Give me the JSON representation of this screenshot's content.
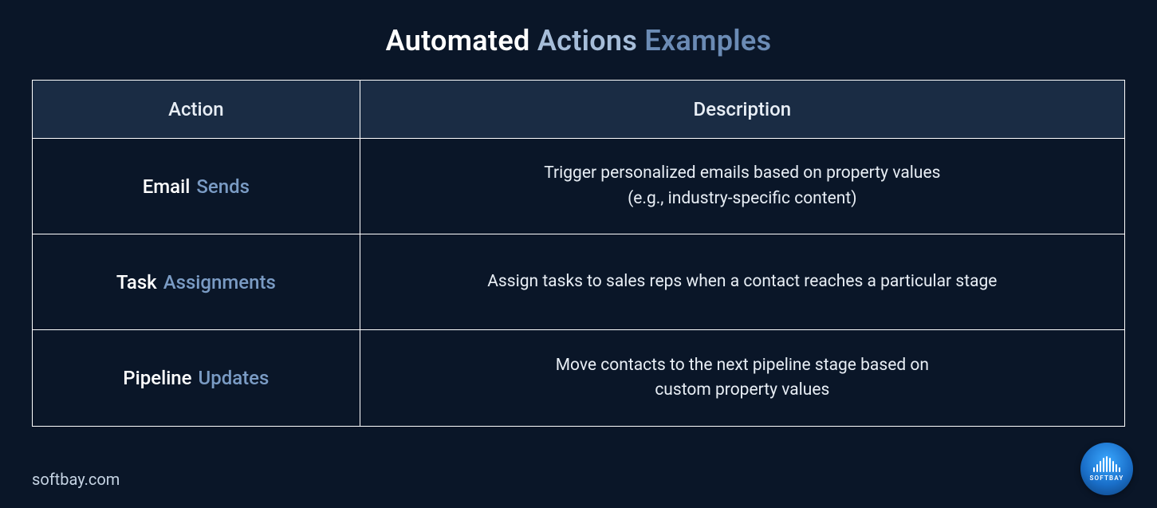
{
  "title": {
    "w1": "Automated",
    "w2": "Actions",
    "w3": "Examples"
  },
  "headers": {
    "action": "Action",
    "description": "Description"
  },
  "rows": [
    {
      "action_w1": "Email",
      "action_w2": "Sends",
      "description": "Trigger personalized emails based on property values\n(e.g., industry-specific content)"
    },
    {
      "action_w1": "Task",
      "action_w2": "Assignments",
      "description": "Assign tasks to sales reps when a contact reaches a particular stage"
    },
    {
      "action_w1": "Pipeline",
      "action_w2": "Updates",
      "description": "Move contacts to the next pipeline stage based on\ncustom property values"
    }
  ],
  "footer": "softbay.com",
  "logo_text": "SOFTBAY"
}
